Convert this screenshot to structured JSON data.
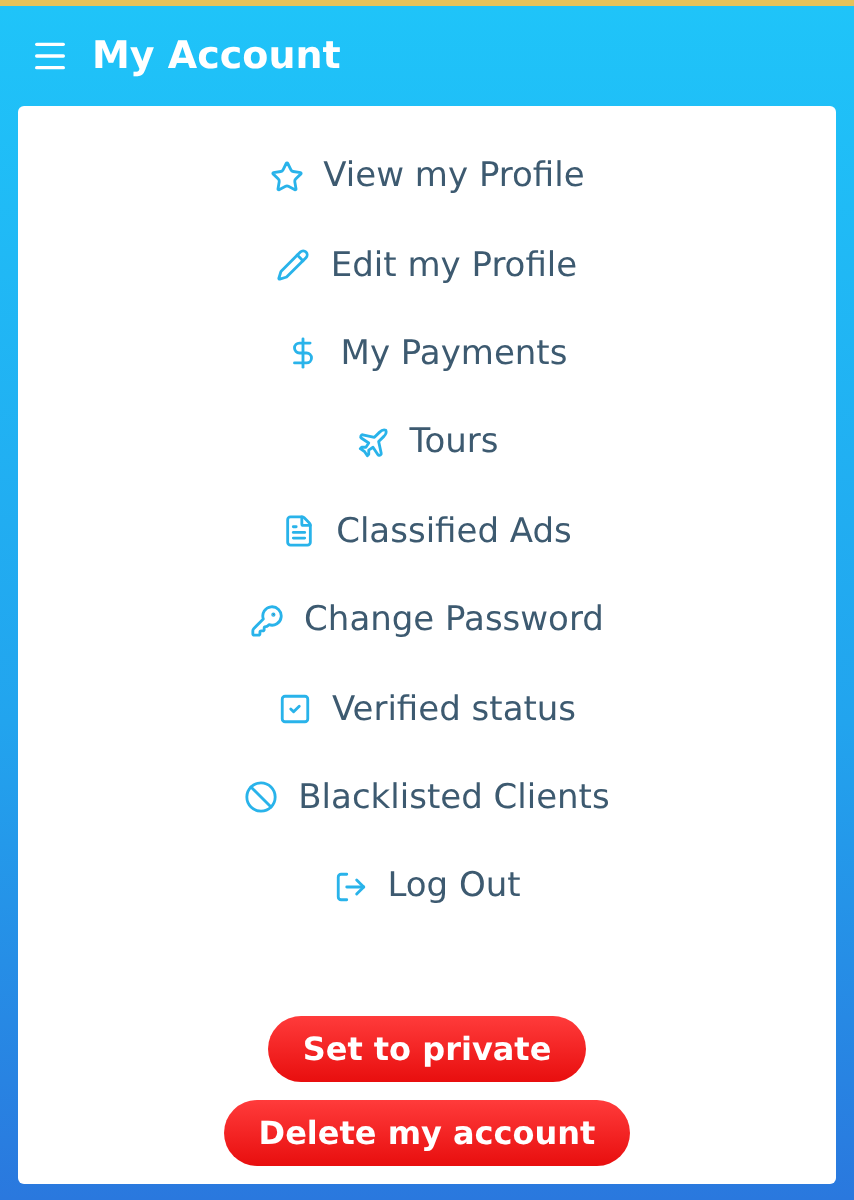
{
  "header": {
    "title": "My Account"
  },
  "menu": [
    "View my Profile",
    "Edit my Profile",
    "My Payments",
    "Tours",
    "Classified Ads",
    "Change Password",
    "Verified status",
    "Blacklisted Clients",
    "Log Out"
  ],
  "buttons": [
    "Set to private",
    "Delete my account"
  ]
}
